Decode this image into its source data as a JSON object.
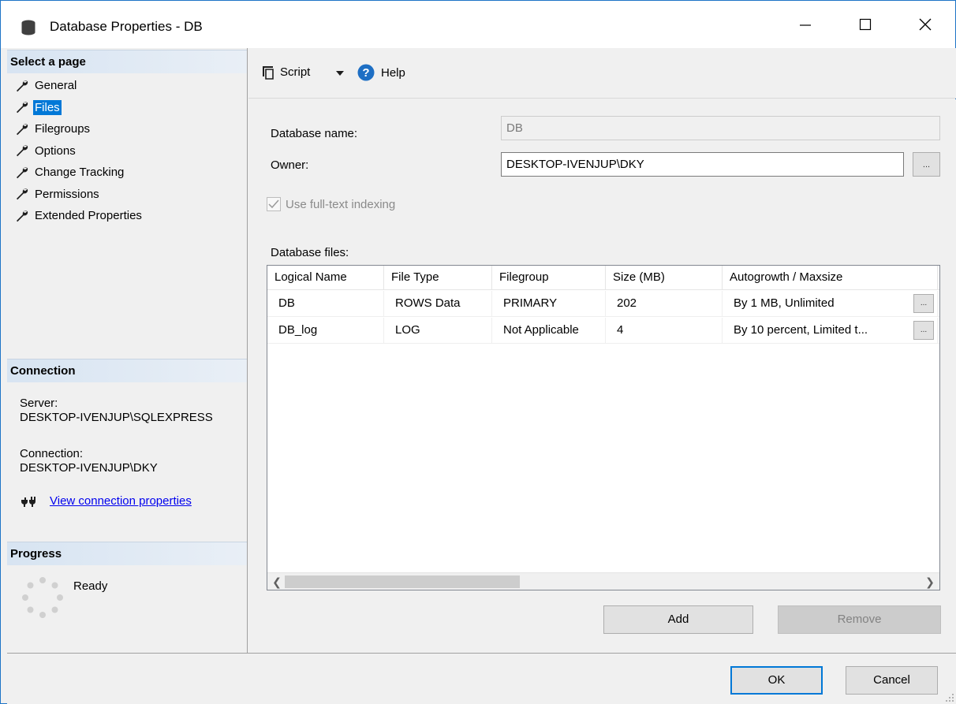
{
  "window": {
    "title": "Database Properties - DB",
    "icon": "database-icon",
    "controls": {
      "minimize": "minimize-icon",
      "maximize": "maximize-icon",
      "close": "close-icon"
    }
  },
  "left_pane": {
    "select_page_header": "Select a page",
    "pages": [
      {
        "label": "General",
        "selected": false
      },
      {
        "label": "Files",
        "selected": true
      },
      {
        "label": "Filegroups",
        "selected": false
      },
      {
        "label": "Options",
        "selected": false
      },
      {
        "label": "Change Tracking",
        "selected": false
      },
      {
        "label": "Permissions",
        "selected": false
      },
      {
        "label": "Extended Properties",
        "selected": false
      }
    ],
    "connection_header": "Connection",
    "server_label": "Server:",
    "server_value": "DESKTOP-IVENJUP\\SQLEXPRESS",
    "connection_label": "Connection:",
    "connection_value": "DESKTOP-IVENJUP\\DKY",
    "view_connection_link": "View connection properties",
    "progress_header": "Progress",
    "progress_status": "Ready"
  },
  "toolbar": {
    "script_label": "Script",
    "help_label": "Help"
  },
  "form": {
    "database_name_label": "Database name:",
    "database_name_value": "DB",
    "owner_label": "Owner:",
    "owner_value": "DESKTOP-IVENJUP\\DKY",
    "owner_browse": "...",
    "fulltext_label": "Use full-text indexing",
    "fulltext_checked": true,
    "database_files_label": "Database files:"
  },
  "files_grid": {
    "columns": [
      "Logical Name",
      "File Type",
      "Filegroup",
      "Size (MB)",
      "Autogrowth / Maxsize"
    ],
    "rows": [
      [
        "DB",
        "ROWS Data",
        "PRIMARY",
        "202",
        "By 1 MB, Unlimited"
      ],
      [
        "DB_log",
        "LOG",
        "Not Applicable",
        "4",
        "By 10 percent, Limited t..."
      ]
    ],
    "cell_button": "..."
  },
  "grid_buttons": {
    "add": "Add",
    "remove": "Remove"
  },
  "footer": {
    "ok": "OK",
    "cancel": "Cancel"
  }
}
